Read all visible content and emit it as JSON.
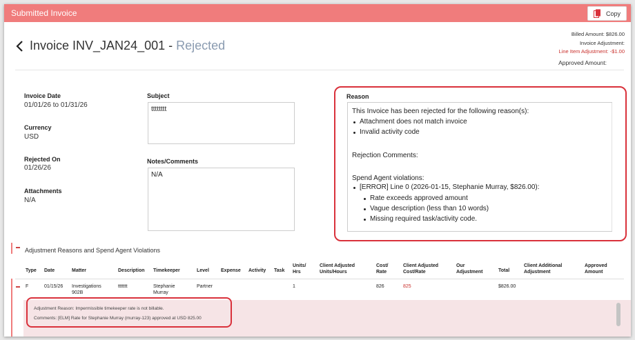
{
  "window": {
    "title": "Submitted Invoice",
    "copy_label": "Copy"
  },
  "header": {
    "invoice_name": "Invoice INV_JAN24_001",
    "separator": " - ",
    "status": "Rejected",
    "billed_amount": "Billed Amount: $826.00",
    "invoice_adjustment": "Invoice Adjustment:",
    "line_item_adjustment": "Line Item Adjustment: -$1.00",
    "approved_amount": "Approved Amount:"
  },
  "details": {
    "invoice_date_label": "Invoice Date",
    "invoice_date_value": "01/01/26 to 01/31/26",
    "currency_label": "Currency",
    "currency_value": "USD",
    "rejected_on_label": "Rejected On",
    "rejected_on_value": "01/26/26",
    "attachments_label": "Attachments",
    "attachments_value": "N/A",
    "subject_label": "Subject",
    "subject_value": "tttttttt",
    "notes_label": "Notes/Comments",
    "notes_value": "N/A"
  },
  "reason": {
    "label": "Reason",
    "intro": "This Invoice has been rejected for the following reason(s):",
    "reasons": [
      "Attachment does not match invoice",
      "Invalid activity code"
    ],
    "comments_label": "Rejection Comments:",
    "violations_label": "Spend Agent violations:",
    "violation_line": "[ERROR] Line 0 (2026-01-15, Stephanie Murray, $826.00):",
    "violation_details": [
      "Rate exceeds approved amount",
      "Vague description (less than 10 words)",
      "Missing required task/activity code."
    ]
  },
  "section": {
    "title": "Adjustment Reasons and Spend Agent Violations"
  },
  "table": {
    "headers": [
      "Type",
      "Date",
      "Matter",
      "Description",
      "Timekeeper",
      "Level",
      "Expense",
      "Activity",
      "Task",
      "Units/ Hrs",
      "Client Adjusted Units/Hours",
      "Cost/ Rate",
      "Client Adjusted Cost/Rate",
      "Our Adjustment",
      "Total",
      "Client Additional Adjustment",
      "Approved Amount"
    ],
    "row": {
      "type": "F",
      "date": "01/15/26",
      "matter": "Investigations 902B",
      "description": "ttttttt",
      "timekeeper": "Stephanie Murray",
      "level": "Partner",
      "units": "1",
      "cost_rate": "826",
      "client_adjusted_cost_rate": "825",
      "total": "$826.00"
    },
    "adjustment_reason": "Adjustment Reason: Impermissible timekeeper rate is not billable.",
    "adjustment_comments": "Comments: [ELM] Rate for Stephanie Murray (murray-123) approved at USD 825.00"
  },
  "colors": {
    "titlebar": "#f07c7c",
    "highlight": "#d9303a",
    "status": "#8a9bb0",
    "adjustment_red": "#c9302c"
  }
}
